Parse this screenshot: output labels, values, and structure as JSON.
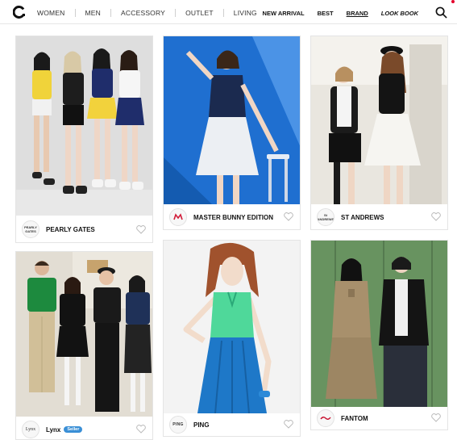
{
  "header": {
    "nav_left": [
      "WOMEN",
      "MEN",
      "ACCESSORY",
      "OUTLET",
      "LIVING"
    ],
    "nav_right": [
      "NEW ARRIVAL",
      "BEST",
      "BRAND",
      "LOOK BOOK"
    ],
    "active_item": "BRAND"
  },
  "cards": [
    {
      "brand": "PEARLY GATES",
      "logo_text": "PEARLY GATES",
      "badge": ""
    },
    {
      "brand": "MASTER BUNNY EDITION",
      "logo_text": "",
      "badge": ""
    },
    {
      "brand": "ST ANDREWS",
      "logo_text": "St ANDREWS",
      "badge": ""
    },
    {
      "brand": "Lynx",
      "logo_text": "Lynx",
      "badge": "Seller"
    },
    {
      "brand": "PING",
      "logo_text": "PING",
      "badge": ""
    },
    {
      "brand": "FANTOM",
      "logo_text": "",
      "badge": ""
    }
  ],
  "colors": {
    "accent_badge": "#3a8fd6",
    "notification_dot": "#e4002b",
    "master_bunny_logo": "#d21d3a",
    "fantom_logo": "#c8102e"
  }
}
